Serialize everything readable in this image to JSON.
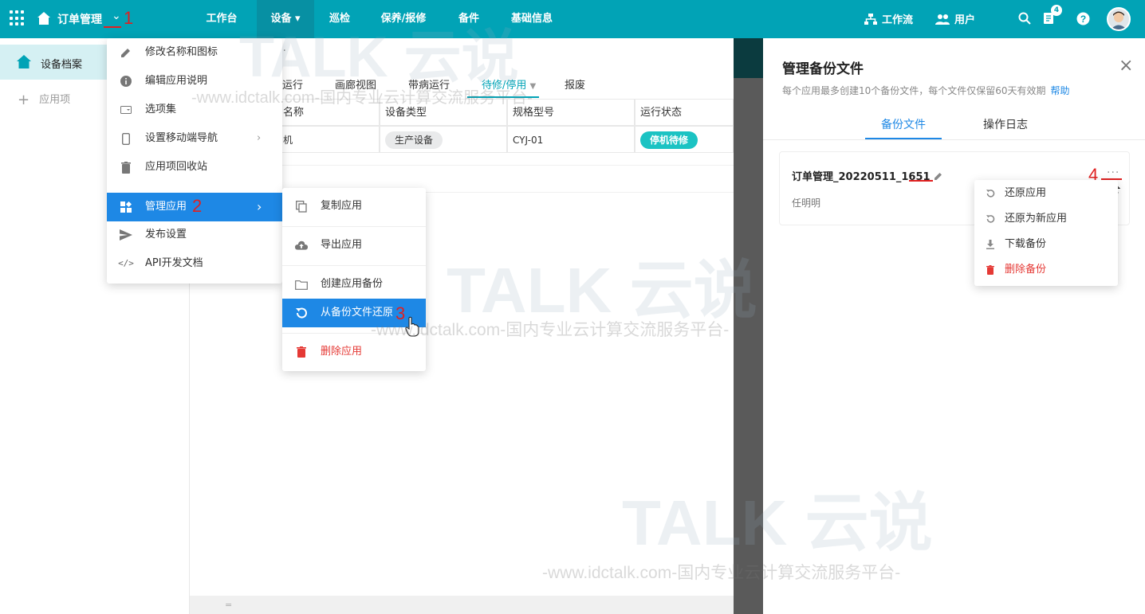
{
  "topbar": {
    "app_name": "订单管理",
    "nav": [
      "工作台",
      "设备",
      "巡检",
      "保养/报修",
      "备件",
      "基础信息"
    ],
    "workflow": "工作流",
    "users": "用户",
    "notification_count": "4",
    "colors": {
      "bar": "#01a3b6",
      "active": "#0790a3"
    }
  },
  "annotations": [
    "1",
    "2",
    "3",
    "4"
  ],
  "sidebar": {
    "active_item": "设备档案",
    "add_item": "应用项"
  },
  "main": {
    "tabs": [
      "运行",
      "画廊视图",
      "带病运行",
      "待修/停用",
      "报废"
    ],
    "table": {
      "headers": [
        "名称",
        "设备类型",
        "规格型号",
        "运行状态"
      ],
      "row": [
        "机",
        "生产设备",
        "CYJ-01",
        "停机待修"
      ]
    },
    "footer": "="
  },
  "app_menu": {
    "items": [
      "修改名称和图标",
      "编辑应用说明",
      "选项集",
      "设置移动端导航",
      "应用项回收站",
      "管理应用",
      "发布设置",
      "API开发文档"
    ]
  },
  "manage_submenu": {
    "items": [
      "复制应用",
      "导出应用",
      "创建应用备份",
      "从备份文件还原",
      "删除应用"
    ]
  },
  "backup_panel": {
    "title": "管理备份文件",
    "description": "每个应用最多创建10个备份文件，每个文件仅保留60天有效期",
    "help": "帮助",
    "tabs": [
      "备份文件",
      "操作日志"
    ],
    "backup": {
      "name": "订单管理_20220511_1651",
      "author": "任明明"
    },
    "more": "···"
  },
  "backup_menu": {
    "items": [
      "还原应用",
      "还原为新应用",
      "下载备份",
      "删除备份"
    ]
  },
  "watermark": {
    "logo": "TALK 云说",
    "subtitle": "-www.idctalk.com-国内专业云计算交流服务平台-"
  }
}
